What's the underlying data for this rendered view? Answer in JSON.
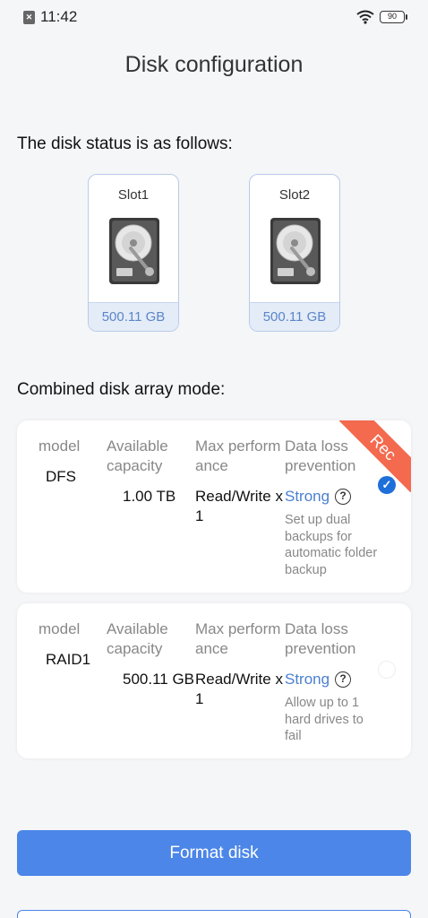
{
  "status_bar": {
    "time": "11:42",
    "battery": "90",
    "icons": [
      "notification-icon",
      "wifi-icon",
      "battery-icon"
    ]
  },
  "title": "Disk configuration",
  "disk_status": {
    "heading": "The disk status is as follows:",
    "slots": [
      {
        "label": "Slot1",
        "size": "500.11 GB",
        "icon": "hard-drive-icon"
      },
      {
        "label": "Slot2",
        "size": "500.11 GB",
        "icon": "hard-drive-icon"
      }
    ]
  },
  "array_mode": {
    "heading": "Combined disk array mode:",
    "column_labels": {
      "model": "model",
      "capacity": "Available capacity",
      "performance": "Max performance",
      "protection": "Data loss prevention"
    },
    "options": [
      {
        "model": "DFS",
        "capacity": "1.00 TB",
        "performance": "Read/Write x1",
        "protection_level": "Strong",
        "protection_desc": "Set up dual backups for automatic folder backup",
        "selected": true,
        "badge": "Rec"
      },
      {
        "model": "RAID1",
        "capacity": "500.11 GB",
        "performance": "Read/Write x1",
        "protection_level": "Strong",
        "protection_desc": "Allow up to 1 hard drives to fail",
        "selected": false
      }
    ]
  },
  "buttons": {
    "format": "Format disk"
  },
  "colors": {
    "accent": "#4b86e8",
    "strong_text": "#4a7fd0",
    "badge": "#f36a4e",
    "slot_size_bg": "#e4ecf8"
  }
}
